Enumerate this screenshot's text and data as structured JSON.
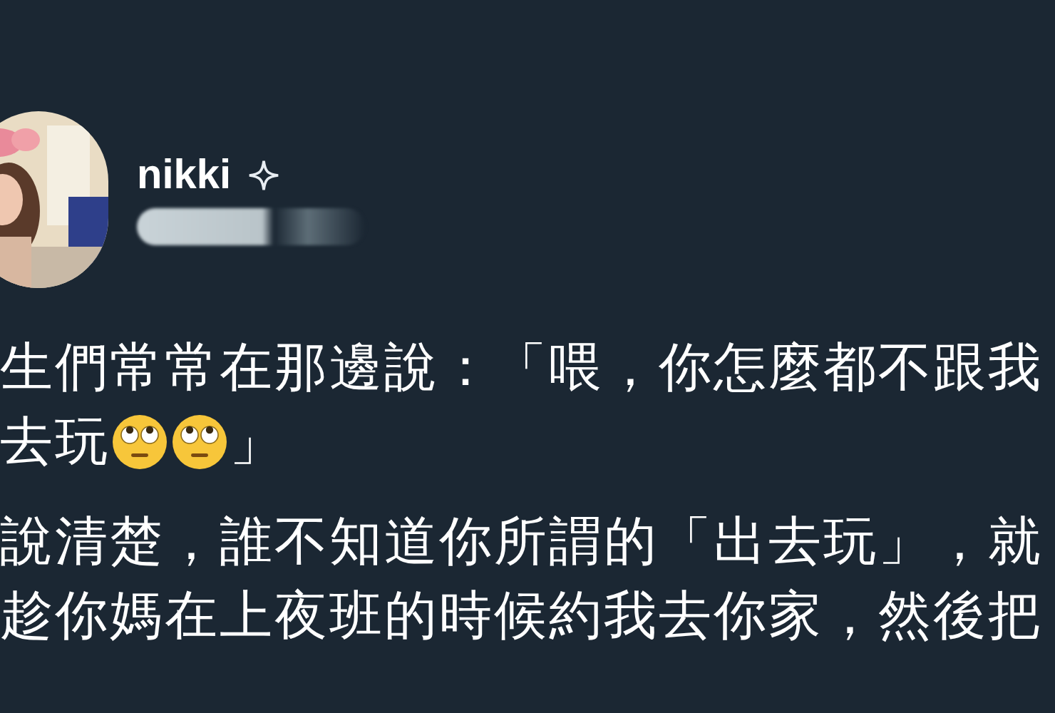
{
  "post": {
    "author": {
      "name": "nikki",
      "verified_icon": true
    },
    "paragraphs": [
      {
        "lines": [
          [
            {
              "kind": "text",
              "text": "生們常常在那邊說：「喂，你怎麼都不跟我"
            }
          ],
          [
            {
              "kind": "text",
              "text": "去玩"
            },
            {
              "kind": "emoji"
            },
            {
              "kind": "emoji"
            },
            {
              "kind": "text",
              "text": " 」"
            }
          ]
        ]
      },
      {
        "lines": [
          [
            {
              "kind": "text",
              "text": "說清楚，誰不知道你所謂的「出去玩」，就"
            }
          ],
          [
            {
              "kind": "text",
              "text": "趁你媽在上夜班的時候約我去你家，然後把"
            }
          ]
        ]
      }
    ]
  }
}
